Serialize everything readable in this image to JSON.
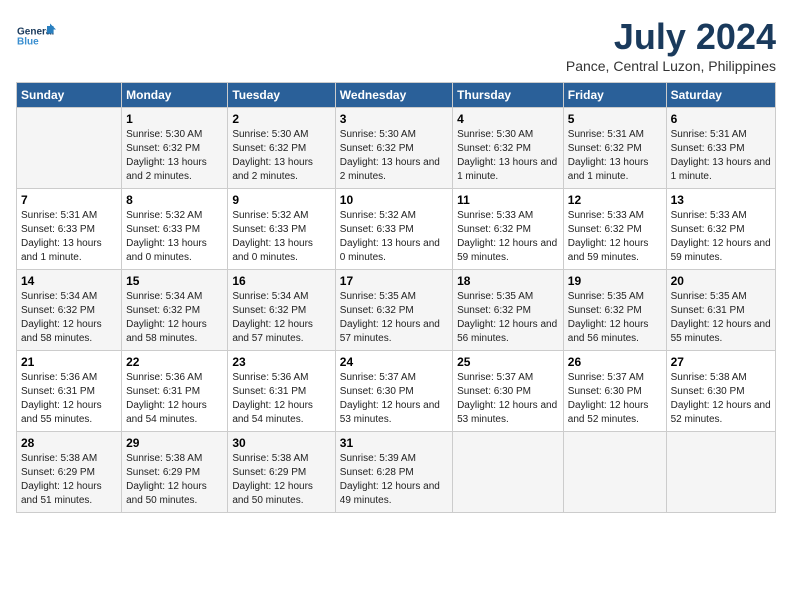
{
  "logo": {
    "line1": "General",
    "line2": "Blue"
  },
  "title": "July 2024",
  "subtitle": "Pance, Central Luzon, Philippines",
  "days_header": [
    "Sunday",
    "Monday",
    "Tuesday",
    "Wednesday",
    "Thursday",
    "Friday",
    "Saturday"
  ],
  "weeks": [
    [
      {
        "day": "",
        "sunrise": "",
        "sunset": "",
        "daylight": ""
      },
      {
        "day": "1",
        "sunrise": "Sunrise: 5:30 AM",
        "sunset": "Sunset: 6:32 PM",
        "daylight": "Daylight: 13 hours and 2 minutes."
      },
      {
        "day": "2",
        "sunrise": "Sunrise: 5:30 AM",
        "sunset": "Sunset: 6:32 PM",
        "daylight": "Daylight: 13 hours and 2 minutes."
      },
      {
        "day": "3",
        "sunrise": "Sunrise: 5:30 AM",
        "sunset": "Sunset: 6:32 PM",
        "daylight": "Daylight: 13 hours and 2 minutes."
      },
      {
        "day": "4",
        "sunrise": "Sunrise: 5:30 AM",
        "sunset": "Sunset: 6:32 PM",
        "daylight": "Daylight: 13 hours and 1 minute."
      },
      {
        "day": "5",
        "sunrise": "Sunrise: 5:31 AM",
        "sunset": "Sunset: 6:32 PM",
        "daylight": "Daylight: 13 hours and 1 minute."
      },
      {
        "day": "6",
        "sunrise": "Sunrise: 5:31 AM",
        "sunset": "Sunset: 6:33 PM",
        "daylight": "Daylight: 13 hours and 1 minute."
      }
    ],
    [
      {
        "day": "7",
        "sunrise": "Sunrise: 5:31 AM",
        "sunset": "Sunset: 6:33 PM",
        "daylight": "Daylight: 13 hours and 1 minute."
      },
      {
        "day": "8",
        "sunrise": "Sunrise: 5:32 AM",
        "sunset": "Sunset: 6:33 PM",
        "daylight": "Daylight: 13 hours and 0 minutes."
      },
      {
        "day": "9",
        "sunrise": "Sunrise: 5:32 AM",
        "sunset": "Sunset: 6:33 PM",
        "daylight": "Daylight: 13 hours and 0 minutes."
      },
      {
        "day": "10",
        "sunrise": "Sunrise: 5:32 AM",
        "sunset": "Sunset: 6:33 PM",
        "daylight": "Daylight: 13 hours and 0 minutes."
      },
      {
        "day": "11",
        "sunrise": "Sunrise: 5:33 AM",
        "sunset": "Sunset: 6:32 PM",
        "daylight": "Daylight: 12 hours and 59 minutes."
      },
      {
        "day": "12",
        "sunrise": "Sunrise: 5:33 AM",
        "sunset": "Sunset: 6:32 PM",
        "daylight": "Daylight: 12 hours and 59 minutes."
      },
      {
        "day": "13",
        "sunrise": "Sunrise: 5:33 AM",
        "sunset": "Sunset: 6:32 PM",
        "daylight": "Daylight: 12 hours and 59 minutes."
      }
    ],
    [
      {
        "day": "14",
        "sunrise": "Sunrise: 5:34 AM",
        "sunset": "Sunset: 6:32 PM",
        "daylight": "Daylight: 12 hours and 58 minutes."
      },
      {
        "day": "15",
        "sunrise": "Sunrise: 5:34 AM",
        "sunset": "Sunset: 6:32 PM",
        "daylight": "Daylight: 12 hours and 58 minutes."
      },
      {
        "day": "16",
        "sunrise": "Sunrise: 5:34 AM",
        "sunset": "Sunset: 6:32 PM",
        "daylight": "Daylight: 12 hours and 57 minutes."
      },
      {
        "day": "17",
        "sunrise": "Sunrise: 5:35 AM",
        "sunset": "Sunset: 6:32 PM",
        "daylight": "Daylight: 12 hours and 57 minutes."
      },
      {
        "day": "18",
        "sunrise": "Sunrise: 5:35 AM",
        "sunset": "Sunset: 6:32 PM",
        "daylight": "Daylight: 12 hours and 56 minutes."
      },
      {
        "day": "19",
        "sunrise": "Sunrise: 5:35 AM",
        "sunset": "Sunset: 6:32 PM",
        "daylight": "Daylight: 12 hours and 56 minutes."
      },
      {
        "day": "20",
        "sunrise": "Sunrise: 5:35 AM",
        "sunset": "Sunset: 6:31 PM",
        "daylight": "Daylight: 12 hours and 55 minutes."
      }
    ],
    [
      {
        "day": "21",
        "sunrise": "Sunrise: 5:36 AM",
        "sunset": "Sunset: 6:31 PM",
        "daylight": "Daylight: 12 hours and 55 minutes."
      },
      {
        "day": "22",
        "sunrise": "Sunrise: 5:36 AM",
        "sunset": "Sunset: 6:31 PM",
        "daylight": "Daylight: 12 hours and 54 minutes."
      },
      {
        "day": "23",
        "sunrise": "Sunrise: 5:36 AM",
        "sunset": "Sunset: 6:31 PM",
        "daylight": "Daylight: 12 hours and 54 minutes."
      },
      {
        "day": "24",
        "sunrise": "Sunrise: 5:37 AM",
        "sunset": "Sunset: 6:30 PM",
        "daylight": "Daylight: 12 hours and 53 minutes."
      },
      {
        "day": "25",
        "sunrise": "Sunrise: 5:37 AM",
        "sunset": "Sunset: 6:30 PM",
        "daylight": "Daylight: 12 hours and 53 minutes."
      },
      {
        "day": "26",
        "sunrise": "Sunrise: 5:37 AM",
        "sunset": "Sunset: 6:30 PM",
        "daylight": "Daylight: 12 hours and 52 minutes."
      },
      {
        "day": "27",
        "sunrise": "Sunrise: 5:38 AM",
        "sunset": "Sunset: 6:30 PM",
        "daylight": "Daylight: 12 hours and 52 minutes."
      }
    ],
    [
      {
        "day": "28",
        "sunrise": "Sunrise: 5:38 AM",
        "sunset": "Sunset: 6:29 PM",
        "daylight": "Daylight: 12 hours and 51 minutes."
      },
      {
        "day": "29",
        "sunrise": "Sunrise: 5:38 AM",
        "sunset": "Sunset: 6:29 PM",
        "daylight": "Daylight: 12 hours and 50 minutes."
      },
      {
        "day": "30",
        "sunrise": "Sunrise: 5:38 AM",
        "sunset": "Sunset: 6:29 PM",
        "daylight": "Daylight: 12 hours and 50 minutes."
      },
      {
        "day": "31",
        "sunrise": "Sunrise: 5:39 AM",
        "sunset": "Sunset: 6:28 PM",
        "daylight": "Daylight: 12 hours and 49 minutes."
      },
      {
        "day": "",
        "sunrise": "",
        "sunset": "",
        "daylight": ""
      },
      {
        "day": "",
        "sunrise": "",
        "sunset": "",
        "daylight": ""
      },
      {
        "day": "",
        "sunrise": "",
        "sunset": "",
        "daylight": ""
      }
    ]
  ]
}
